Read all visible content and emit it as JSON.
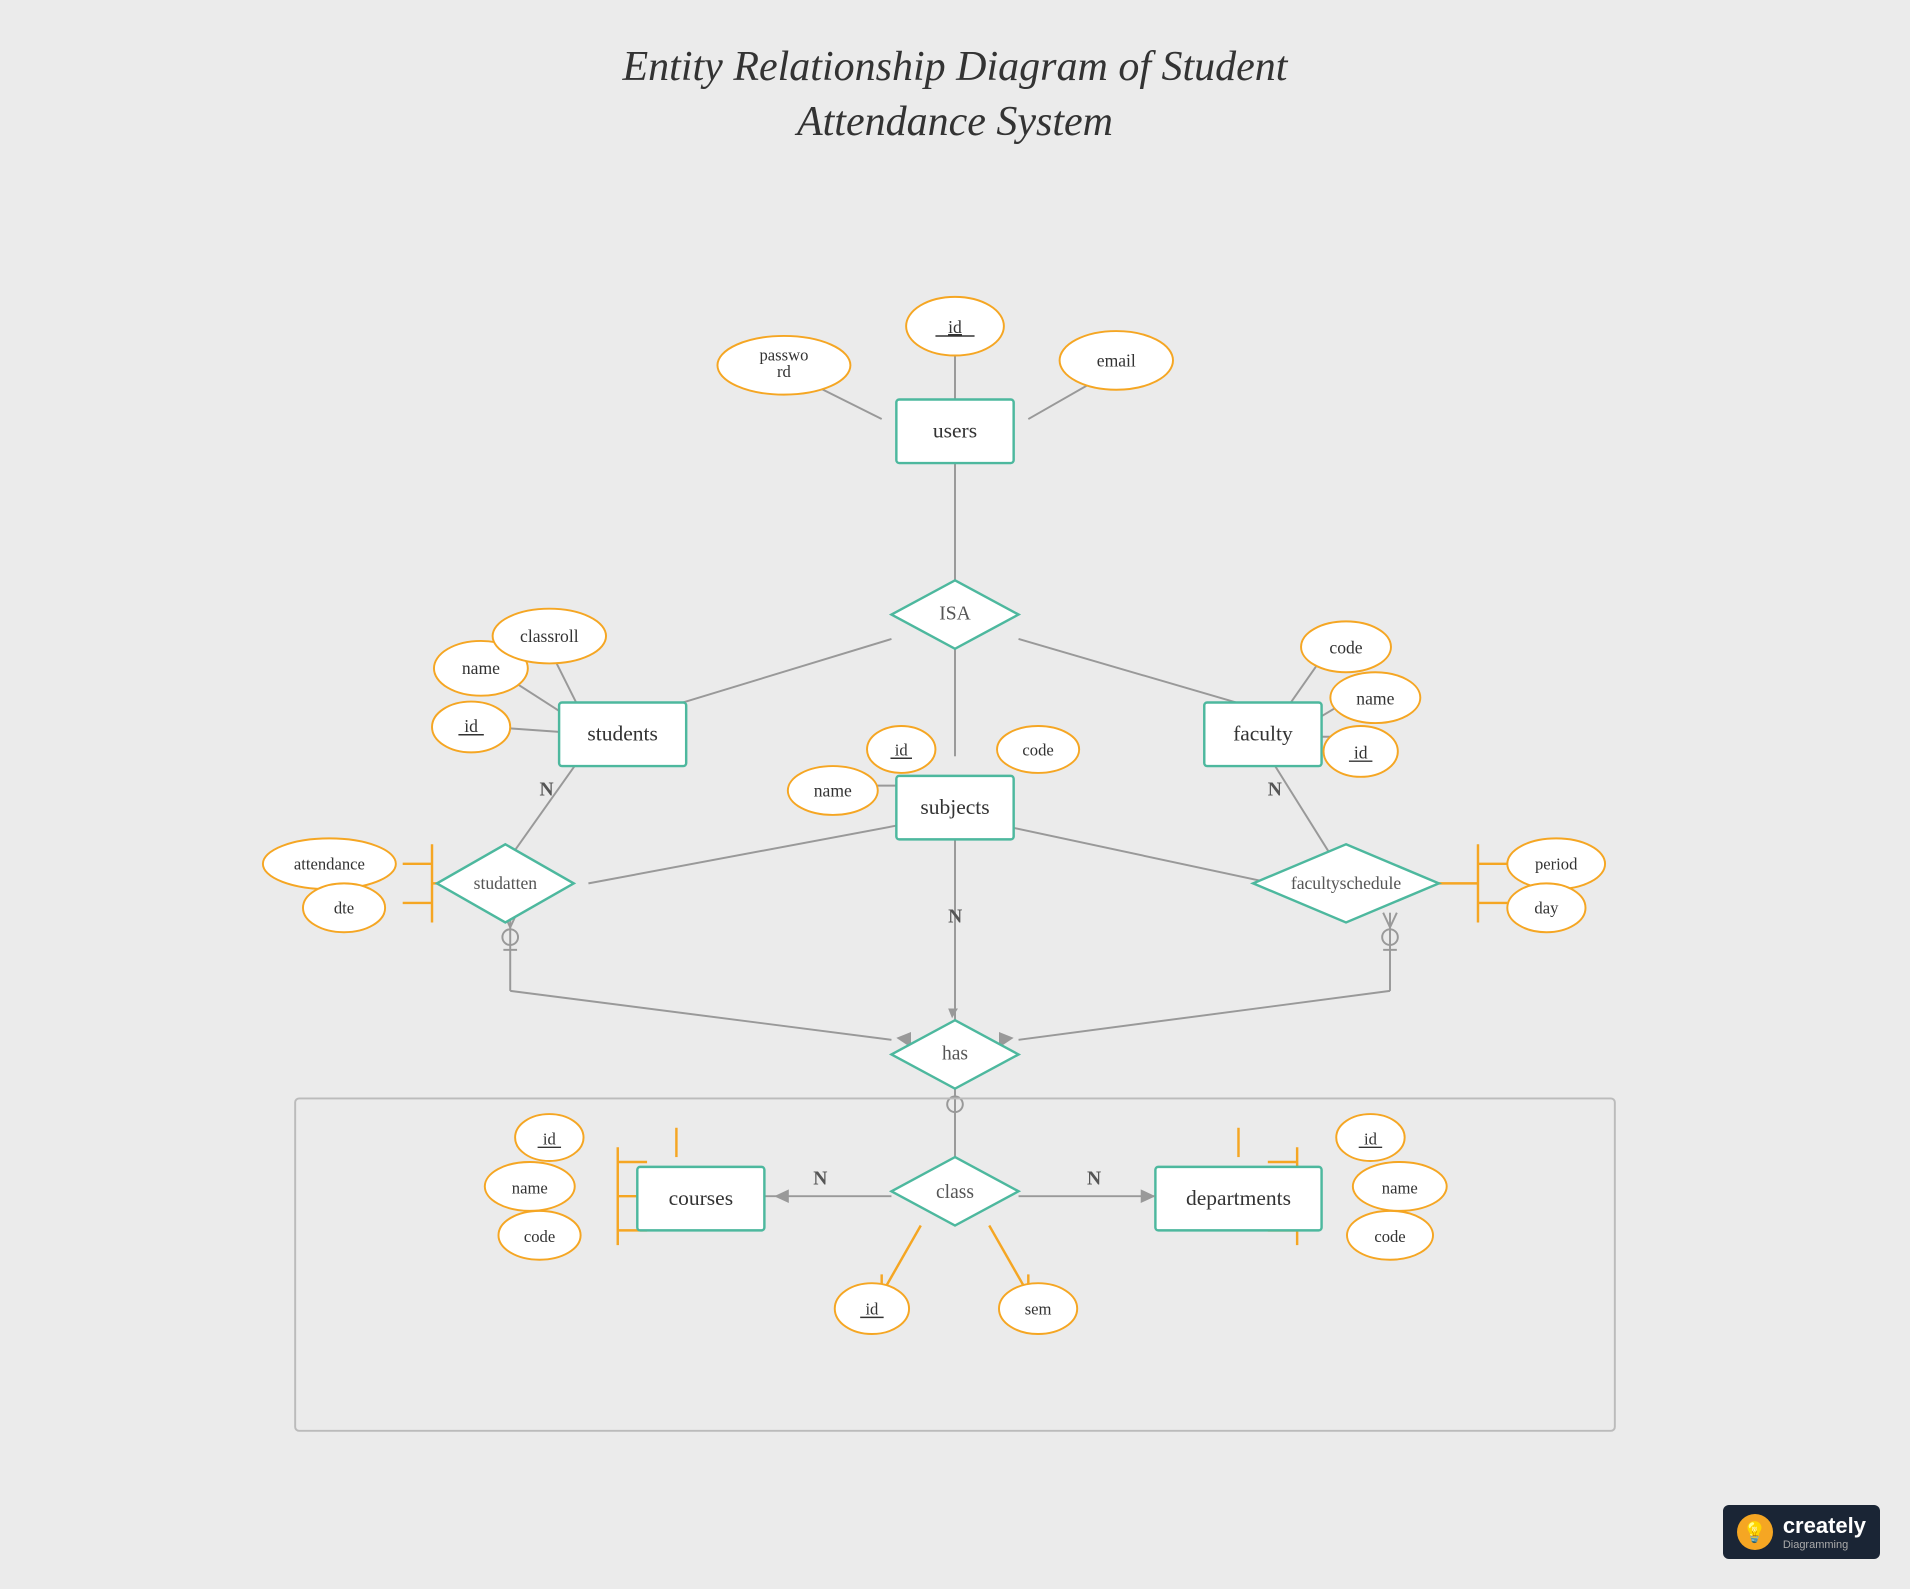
{
  "title": {
    "line1": "Entity Relationship Diagram of Student",
    "line2": "Attendance System"
  },
  "entities": {
    "users": "users",
    "students": "students",
    "faculty": "faculty",
    "subjects": "subjects",
    "courses": "courses",
    "departments": "departments",
    "class": "class"
  },
  "relationships": {
    "isa": "ISA",
    "studatten": "studatten",
    "facultyschedule": "facultyschedule",
    "has": "has"
  },
  "attributes": {
    "id": "id",
    "email": "email",
    "password": "password",
    "name": "name",
    "classroll": "classroll",
    "code": "code",
    "attendance": "attendance",
    "dte": "dte",
    "period": "period",
    "day": "day",
    "sem": "sem"
  },
  "cardinality": {
    "n": "N"
  },
  "logo": {
    "brand": "creately",
    "sub": "Diagramming"
  }
}
